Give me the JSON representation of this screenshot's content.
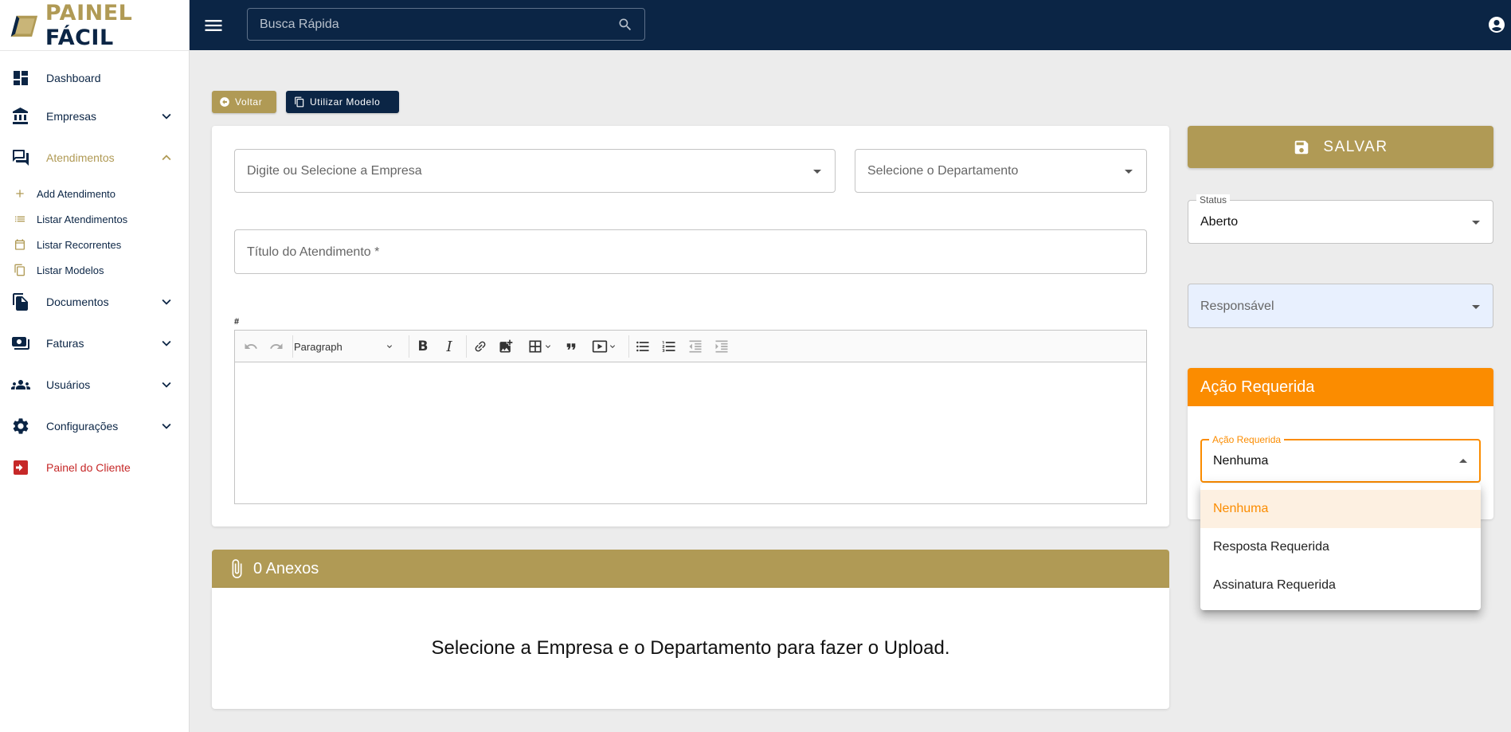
{
  "logo": {
    "word1": "PAINEL",
    "word2": "FÁCIL"
  },
  "topbar": {
    "search_placeholder": "Busca Rápida"
  },
  "sidebar": {
    "items": [
      {
        "label": "Dashboard",
        "icon": "dashboard-icon"
      },
      {
        "label": "Empresas",
        "icon": "bank-icon"
      },
      {
        "label": "Atendimentos",
        "icon": "forum-icon",
        "active": true
      },
      {
        "label": "Documentos",
        "icon": "documents-icon"
      },
      {
        "label": "Faturas",
        "icon": "payments-icon"
      },
      {
        "label": "Usuários",
        "icon": "people-icon"
      },
      {
        "label": "Configurações",
        "icon": "gear-icon"
      },
      {
        "label": "Painel do Cliente",
        "icon": "exit-icon"
      }
    ],
    "subitems": [
      {
        "label": "Add Atendimento",
        "icon": "plus-icon"
      },
      {
        "label": "Listar Atendimentos",
        "icon": "list-icon"
      },
      {
        "label": "Listar Recorrentes",
        "icon": "calendar-icon"
      },
      {
        "label": "Listar Modelos",
        "icon": "copy-icon"
      }
    ]
  },
  "actions": {
    "back_label": "Voltar",
    "template_label": "Utilizar Modelo"
  },
  "form": {
    "company_placeholder": "Digite ou Selecione a Empresa",
    "department_placeholder": "Selecione o Departamento",
    "title_placeholder": "Título do Atendimento *",
    "editor_hash": "#",
    "paragraph_label": "Paragraph"
  },
  "attachments": {
    "title": "0 Anexos",
    "message": "Selecione a Empresa e o Departamento para fazer o Upload."
  },
  "right": {
    "save_label": "SALVAR",
    "status_legend": "Status",
    "status_value": "Aberto",
    "responsible_placeholder": "Responsável",
    "acao_header": "Ação Requerida",
    "acao_legend": "Ação Requerida",
    "acao_value": "Nenhuma",
    "options": [
      "Nenhuma",
      "Resposta Requerida",
      "Assinatura Requerida"
    ]
  },
  "colors": {
    "navy": "#0b2545",
    "gold": "#b09a55",
    "orange": "#fb8c00",
    "danger": "#c62828"
  }
}
